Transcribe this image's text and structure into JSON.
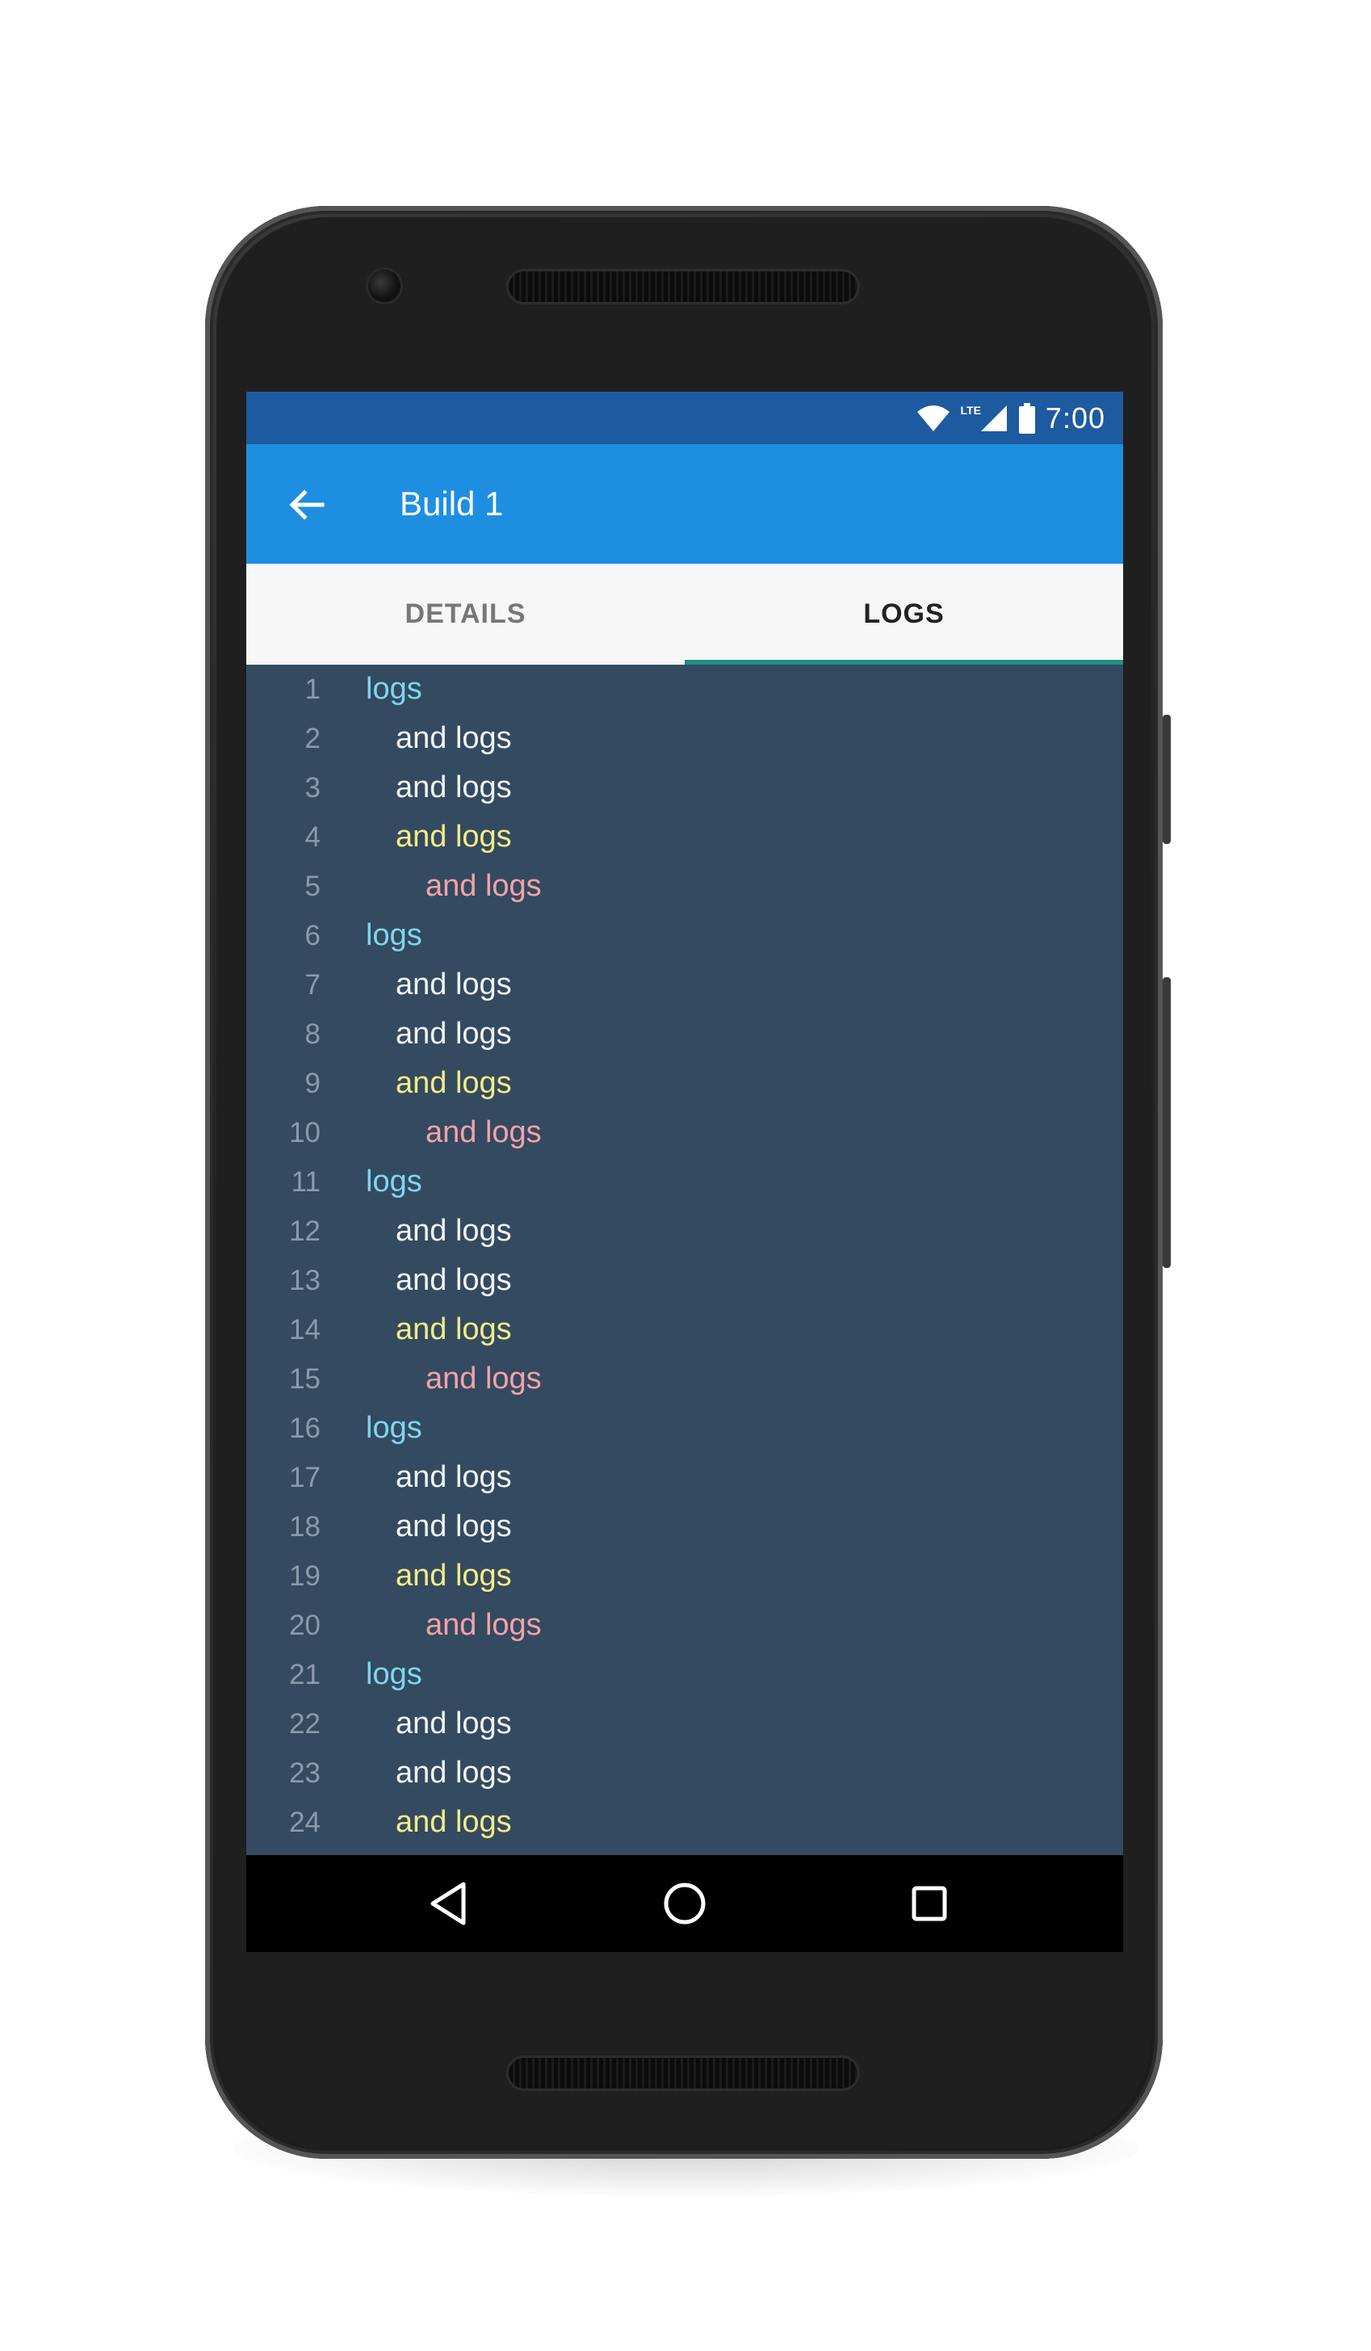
{
  "status_bar": {
    "time": "7:00",
    "network_label": "LTE",
    "icons": [
      "wifi-icon",
      "signal-icon",
      "battery-icon"
    ]
  },
  "app_bar": {
    "title": "Build 1",
    "back_icon": "arrow-left-icon"
  },
  "tabs": [
    {
      "label": "DETAILS",
      "active": false
    },
    {
      "label": "LOGS",
      "active": true
    }
  ],
  "log_lines": [
    {
      "n": "1",
      "text": "logs",
      "indent": 0,
      "color": "#7fd6ec"
    },
    {
      "n": "2",
      "text": "and logs",
      "indent": 1,
      "color": "#f2f4f6"
    },
    {
      "n": "3",
      "text": "and logs",
      "indent": 1,
      "color": "#f2f4f6"
    },
    {
      "n": "4",
      "text": "and logs",
      "indent": 1,
      "color": "#f4ec86"
    },
    {
      "n": "5",
      "text": "and logs",
      "indent": 2,
      "color": "#f4a2a8"
    },
    {
      "n": "6",
      "text": "logs",
      "indent": 0,
      "color": "#7fd6ec"
    },
    {
      "n": "7",
      "text": "and logs",
      "indent": 1,
      "color": "#f2f4f6"
    },
    {
      "n": "8",
      "text": "and logs",
      "indent": 1,
      "color": "#f2f4f6"
    },
    {
      "n": "9",
      "text": "and logs",
      "indent": 1,
      "color": "#f4ec86"
    },
    {
      "n": "10",
      "text": "and logs",
      "indent": 2,
      "color": "#f4a2a8"
    },
    {
      "n": "11",
      "text": "logs",
      "indent": 0,
      "color": "#7fd6ec"
    },
    {
      "n": "12",
      "text": "and logs",
      "indent": 1,
      "color": "#f2f4f6"
    },
    {
      "n": "13",
      "text": "and logs",
      "indent": 1,
      "color": "#f2f4f6"
    },
    {
      "n": "14",
      "text": "and logs",
      "indent": 1,
      "color": "#f4ec86"
    },
    {
      "n": "15",
      "text": "and logs",
      "indent": 2,
      "color": "#f4a2a8"
    },
    {
      "n": "16",
      "text": "logs",
      "indent": 0,
      "color": "#7fd6ec"
    },
    {
      "n": "17",
      "text": "and logs",
      "indent": 1,
      "color": "#f2f4f6"
    },
    {
      "n": "18",
      "text": "and logs",
      "indent": 1,
      "color": "#f2f4f6"
    },
    {
      "n": "19",
      "text": "and logs",
      "indent": 1,
      "color": "#f4ec86"
    },
    {
      "n": "20",
      "text": "and logs",
      "indent": 2,
      "color": "#f4a2a8"
    },
    {
      "n": "21",
      "text": "logs",
      "indent": 0,
      "color": "#7fd6ec"
    },
    {
      "n": "22",
      "text": "and logs",
      "indent": 1,
      "color": "#f2f4f6"
    },
    {
      "n": "23",
      "text": "and logs",
      "indent": 1,
      "color": "#f2f4f6"
    },
    {
      "n": "24",
      "text": "and logs",
      "indent": 1,
      "color": "#f4ec86"
    }
  ],
  "nav_bar": {
    "buttons": [
      "back-triangle-icon",
      "home-circle-icon",
      "recents-square-icon"
    ]
  },
  "colors": {
    "status_bar": "#1d5aa0",
    "app_bar": "#1e8fe0",
    "tab_indicator": "#1e8f84",
    "log_background": "#334a60"
  }
}
